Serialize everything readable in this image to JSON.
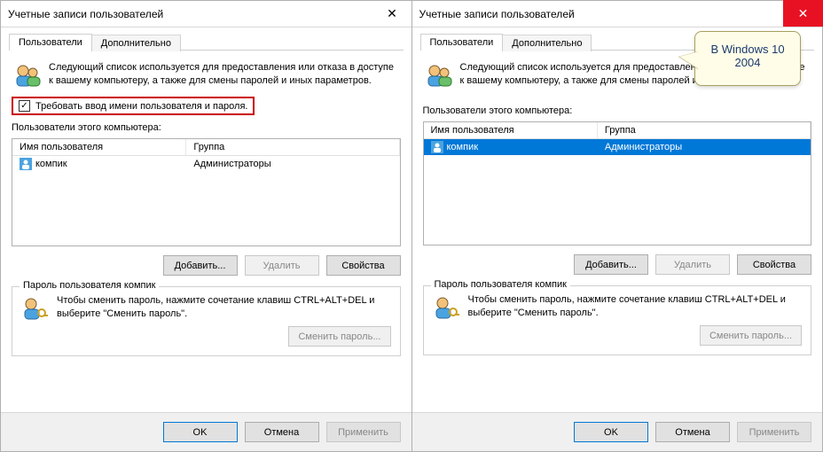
{
  "left": {
    "title": "Учетные записи пользователей",
    "tabs": {
      "users": "Пользователи",
      "advanced": "Дополнительно"
    },
    "intro": "Следующий список используется для предоставления или отказа в доступе к вашему компьютеру, а также для смены паролей и иных параметров.",
    "require_auth_label": "Требовать ввод имени пользователя и пароля.",
    "users_label": "Пользователи этого компьютера:",
    "columns": {
      "name": "Имя пользователя",
      "group": "Группа"
    },
    "rows": [
      {
        "name": "компик",
        "group": "Администраторы"
      }
    ],
    "buttons": {
      "add": "Добавить...",
      "remove": "Удалить",
      "props": "Свойства"
    },
    "pwd_group": "Пароль пользователя компик",
    "pwd_text": "Чтобы сменить пароль, нажмите сочетание клавиш CTRL+ALT+DEL и выберите \"Сменить пароль\".",
    "change_pwd": "Сменить пароль...",
    "footer": {
      "ok": "OK",
      "cancel": "Отмена",
      "apply": "Применить"
    }
  },
  "right": {
    "title": "Учетные записи пользователей",
    "tabs": {
      "users": "Пользователи",
      "advanced": "Дополнительно"
    },
    "intro": "Следующий список используется для предоставления или отказа в доступе к вашему компьютеру, а также для смены паролей и иных параметров.",
    "users_label": "Пользователи этого компьютера:",
    "columns": {
      "name": "Имя пользователя",
      "group": "Группа"
    },
    "rows": [
      {
        "name": "компик",
        "group": "Администраторы"
      }
    ],
    "buttons": {
      "add": "Добавить...",
      "remove": "Удалить",
      "props": "Свойства"
    },
    "pwd_group": "Пароль пользователя компик",
    "pwd_text": "Чтобы сменить пароль, нажмите сочетание клавиш CTRL+ALT+DEL и выберите \"Сменить пароль\".",
    "change_pwd": "Сменить пароль...",
    "footer": {
      "ok": "OK",
      "cancel": "Отмена",
      "apply": "Применить"
    },
    "callout": "В Windows 10 2004"
  }
}
